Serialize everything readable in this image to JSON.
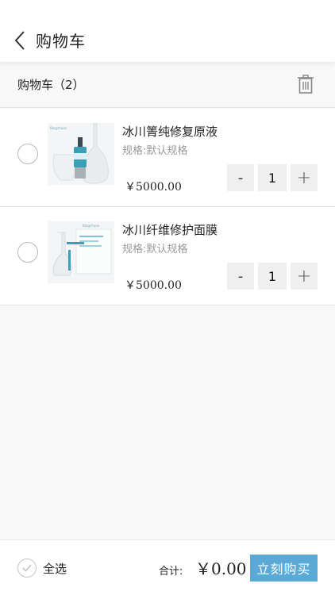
{
  "header": {
    "title": "购物车"
  },
  "subheader": {
    "title": "购物车（2）"
  },
  "items": [
    {
      "name": "冰川箐纯修复原液",
      "spec": "规格:默认规格",
      "price": "￥5000.00",
      "quantity": "1"
    },
    {
      "name": "冰川纤维修护面膜",
      "spec": "规格:默认规格",
      "price": "￥5000.00",
      "quantity": "1"
    }
  ],
  "stepper": {
    "minus": "-",
    "plus": "+"
  },
  "footer": {
    "select_all": "全选",
    "total_label": "合计:",
    "total_value": "￥0.00",
    "buy_label": "立刻购买"
  },
  "colors": {
    "accent": "#5aa9d6",
    "background": "#f8f8f8"
  },
  "icons": {
    "back": "chevron-left-icon",
    "delete": "trash-icon",
    "check": "check-icon"
  }
}
